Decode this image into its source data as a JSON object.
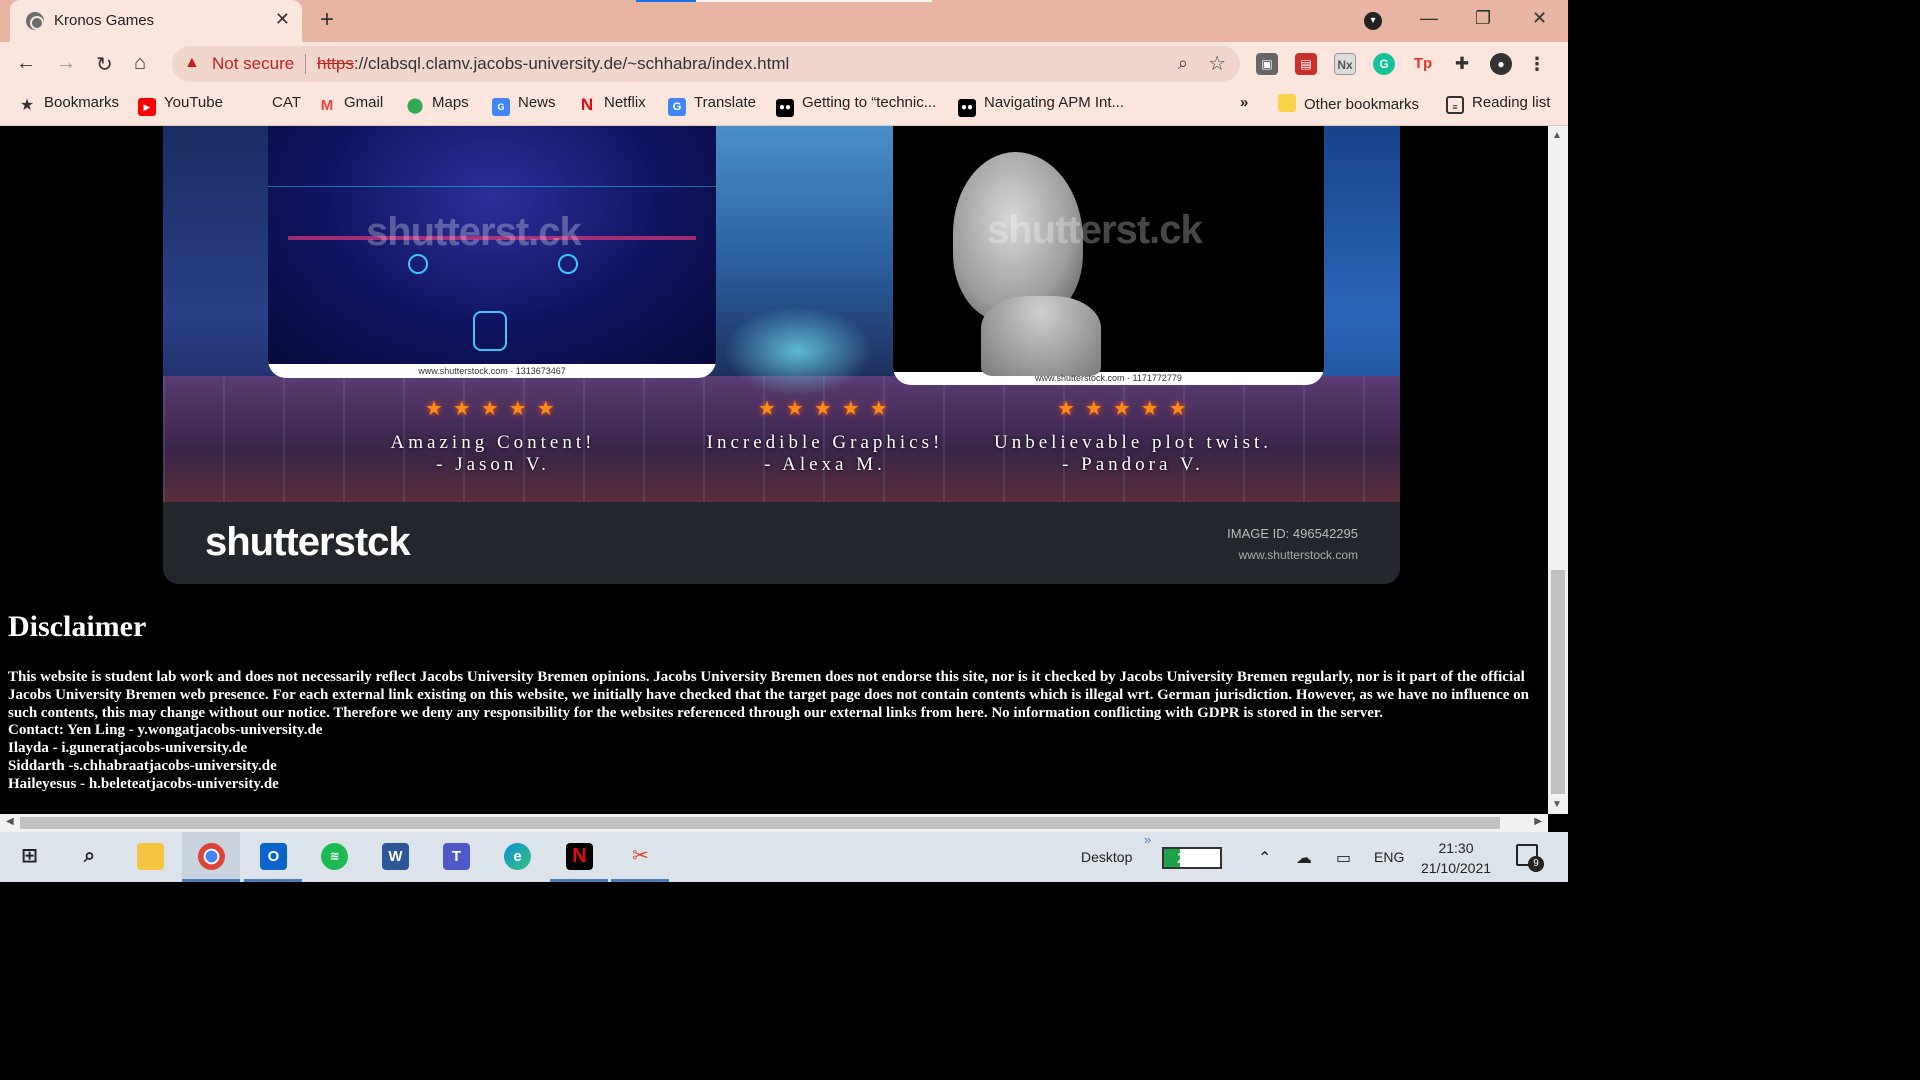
{
  "browser": {
    "tab_title": "Kronos Games",
    "tab_close": "✕",
    "new_tab": "+",
    "not_secure": "Not secure",
    "url_scheme": "https",
    "url_rest": "://clabsql.clamv.jacobs-university.de/~schhabra/index.html",
    "window_buttons": [
      "—",
      "❐",
      "✕"
    ]
  },
  "bookmarks": {
    "items": [
      {
        "label": "Bookmarks",
        "icon": "star-icon"
      },
      {
        "label": "YouTube",
        "icon": "youtube-icon"
      },
      {
        "label": "CAT",
        "icon": ""
      },
      {
        "label": "Gmail",
        "icon": "gmail-icon"
      },
      {
        "label": "Maps",
        "icon": "maps-icon"
      },
      {
        "label": "News",
        "icon": "news-icon"
      },
      {
        "label": "Netflix",
        "icon": "netflix-icon"
      },
      {
        "label": "Translate",
        "icon": "translate-icon"
      },
      {
        "label": "Getting to “technic...",
        "icon": "medium-icon"
      },
      {
        "label": "Navigating APM Int...",
        "icon": "medium-icon"
      }
    ],
    "overflow": "»",
    "other": "Other bookmarks",
    "reading_list": "Reading list"
  },
  "page": {
    "shot1_caption": "www.shutterstock.com · 1313673467",
    "shot2_caption": "www.shutterstock.com · 1171772779",
    "watermark": "shutterst.ck",
    "reviews": [
      {
        "line1": "Amazing Content!",
        "line2": "- Jason V."
      },
      {
        "line1": "Incredible Graphics!",
        "line2": "- Alexa M."
      },
      {
        "line1": "Unbelievable plot twist.",
        "line2": "- Pandora V."
      }
    ],
    "stars": "★★★★★",
    "footer_logo": "shutterstck",
    "image_id_label": "IMAGE ID:",
    "image_id_value": "496542295",
    "footer_site": "www.shutterstock.com",
    "disclaimer_title": "Disclaimer",
    "disclaimer_text": "This website is student lab work and does not necessarily reflect Jacobs University Bremen opinions. Jacobs University Bremen does not endorse this site, nor is it checked by Jacobs University Bremen regularly, nor is it part of the official Jacobs University Bremen web presence. For each external link existing on this website, we initially have checked that the target page does not contain contents which is illegal wrt. German jurisdiction. However, as we have no influence on such contents, this may change without our notice. Therefore we deny any responsibility for the websites referenced through our external links from here. No information conflicting with GDPR is stored in the server.",
    "contacts": [
      "Contact: Yen Ling - y.wongatjacobs-university.de",
      "Ilayda - i.guneratjacobs-university.de",
      "Siddarth -s.chhabraatjacobs-university.de",
      "Haileyesus - h.beleteatjacobs-university.de"
    ]
  },
  "taskbar": {
    "desktop_label": "Desktop",
    "battery": "29%",
    "battery_level": 0.29,
    "language": "ENG",
    "time": "21:30",
    "date": "21/10/2021",
    "notifications": "9"
  },
  "colors": {
    "tab_strip": "#e8b4a3",
    "toolbar": "#fbe6de",
    "not_secure": "#c5221f",
    "stars": "#ff8c1a"
  }
}
